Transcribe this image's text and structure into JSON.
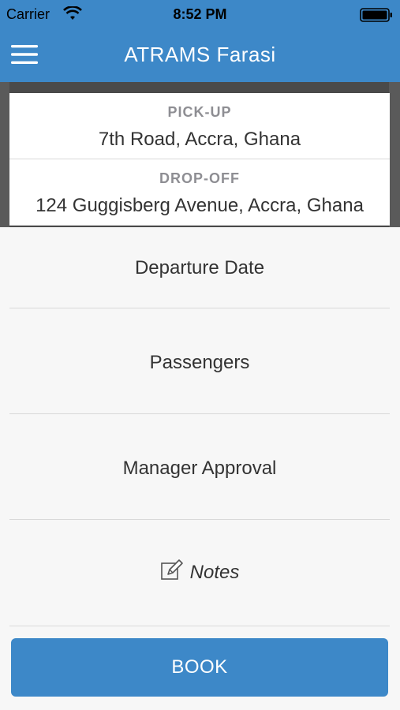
{
  "status_bar": {
    "carrier": "Carrier",
    "time": "8:52 PM"
  },
  "nav": {
    "title": "ATRAMS Farasi",
    "menu_icon": "hamburger-menu-icon"
  },
  "address_card": {
    "pickup_label": "PICK-UP",
    "pickup_value": "7th Road, Accra, Ghana",
    "dropoff_label": "DROP-OFF",
    "dropoff_value": "124 Guggisberg Avenue, Accra, Ghana"
  },
  "form": {
    "departure_date": "Departure Date",
    "passengers": "Passengers",
    "manager_approval": "Manager Approval",
    "notes": "Notes",
    "notes_icon": "edit-note-icon"
  },
  "actions": {
    "book_label": "BOOK"
  },
  "colors": {
    "accent": "#3d88c8",
    "background": "#f7f7f7",
    "label_gray": "#8e8e93"
  }
}
